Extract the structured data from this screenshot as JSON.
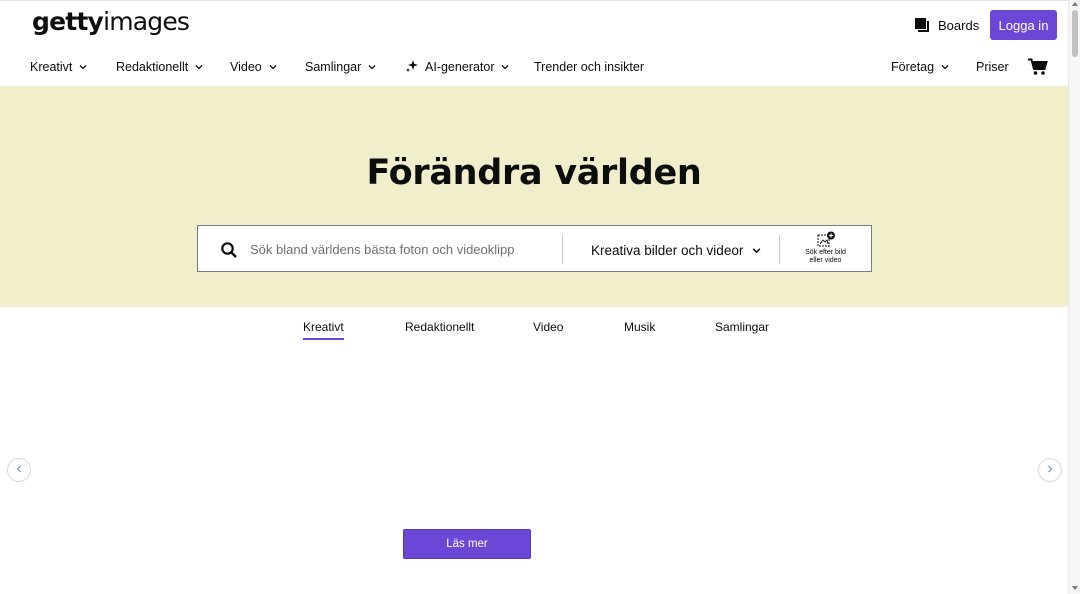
{
  "header": {
    "logo": {
      "bold": "getty",
      "light": "images"
    },
    "boards_label": "Boards",
    "login_label": "Logga in"
  },
  "nav": {
    "items": [
      {
        "label": "Kreativt",
        "has_dropdown": true
      },
      {
        "label": "Redaktionellt",
        "has_dropdown": true
      },
      {
        "label": "Video",
        "has_dropdown": true
      },
      {
        "label": "Samlingar",
        "has_dropdown": true
      },
      {
        "label": "AI-generator",
        "has_dropdown": true,
        "icon": "sparkle-icon"
      },
      {
        "label": "Trender och insikter",
        "has_dropdown": false
      }
    ],
    "right": [
      {
        "label": "Företag",
        "has_dropdown": true
      },
      {
        "label": "Priser",
        "has_dropdown": false
      }
    ],
    "cart_icon": "cart-icon"
  },
  "hero": {
    "title": "Förändra världen",
    "search": {
      "placeholder": "Sök bland världens bästa foton och videoklipp",
      "value": "",
      "type_selected": "Kreativa bilder och videor",
      "visual_search_label_1": "Sök efter bild",
      "visual_search_label_2": "eller video"
    }
  },
  "tabs": {
    "items": [
      "Kreativt",
      "Redaktionellt",
      "Video",
      "Musik",
      "Samlingar"
    ],
    "active": "Kreativt"
  },
  "carousel": {
    "prev_icon": "chevron-left-icon",
    "next_icon": "chevron-right-icon",
    "cta_label": "Läs mer"
  },
  "colors": {
    "accent": "#6c47d6",
    "hero_bg": "#f1efcb",
    "text": "#0c0d0d"
  }
}
